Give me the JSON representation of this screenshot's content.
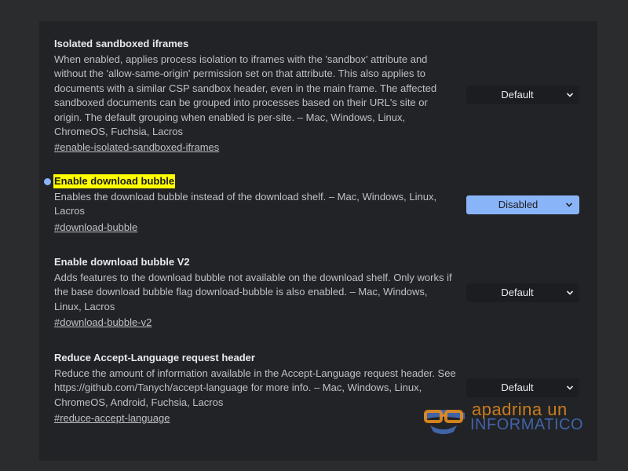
{
  "flags": [
    {
      "title": "Isolated sandboxed iframes",
      "description": "When enabled, applies process isolation to iframes with the 'sandbox' attribute and without the 'allow-same-origin' permission set on that attribute. This also applies to documents with a similar CSP sandbox header, even in the main frame. The affected sandboxed documents can be grouped into processes based on their URL's site or origin. The default grouping when enabled is per-site. – Mac, Windows, Linux, ChromeOS, Fuchsia, Lacros",
      "link": "#enable-isolated-sandboxed-iframes",
      "selected": "Default"
    },
    {
      "title": "Enable download bubble",
      "description": "Enables the download bubble instead of the download shelf. – Mac, Windows, Linux, Lacros",
      "link": "#download-bubble",
      "selected": "Disabled"
    },
    {
      "title": "Enable download bubble V2",
      "description": "Adds features to the download bubble not available on the download shelf. Only works if the base download bubble flag download-bubble is also enabled. – Mac, Windows, Linux, Lacros",
      "link": "#download-bubble-v2",
      "selected": "Default"
    },
    {
      "title": "Reduce Accept-Language request header",
      "description": "Reduce the amount of information available in the Accept-Language request header. See https://github.com/Tanych/accept-language for more info. – Mac, Windows, Linux, ChromeOS, Android, Fuchsia, Lacros",
      "link": "#reduce-accept-language",
      "selected": "Default"
    }
  ],
  "watermark": {
    "line1": "apadrina un",
    "line2": "INFORMATICO"
  },
  "colors": {
    "accent": "#8ab4f8",
    "highlight": "#ffff00",
    "background": "#222326"
  }
}
